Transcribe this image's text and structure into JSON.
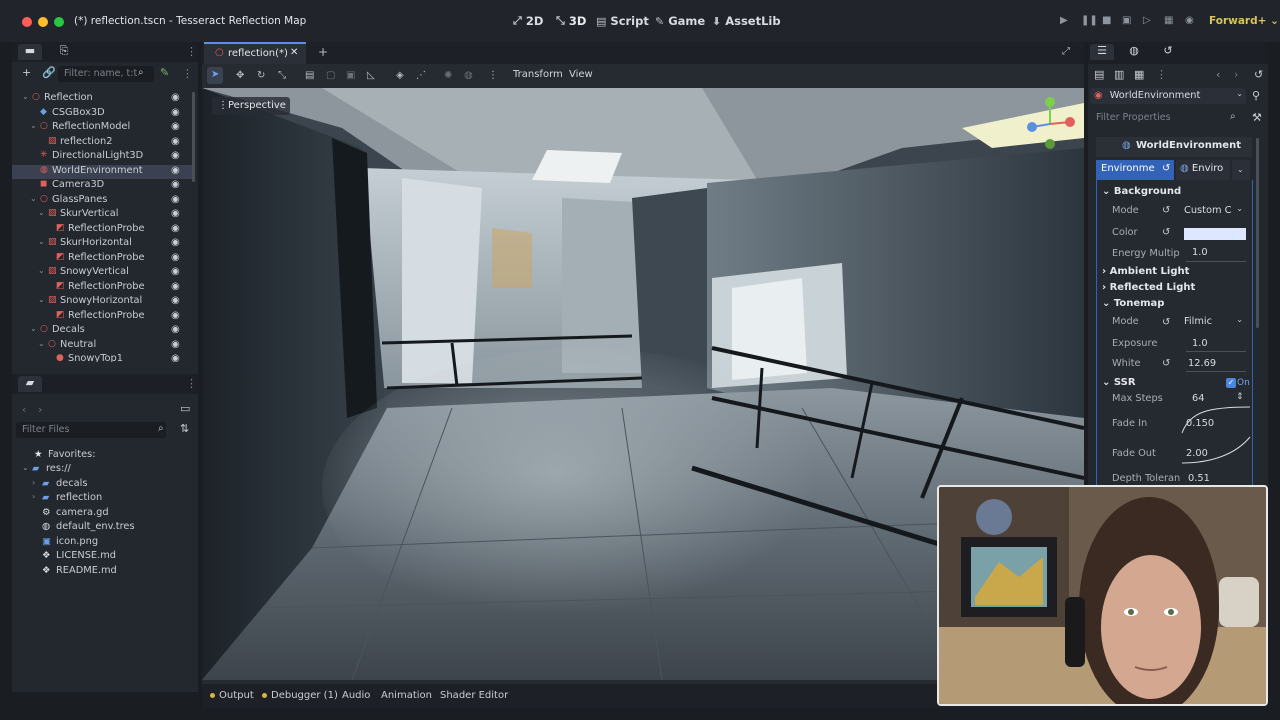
{
  "window": {
    "title": "(*) reflection.tscn - Tesseract Reflection Map",
    "modes": [
      {
        "label": "2D",
        "icon": "2d-icon"
      },
      {
        "label": "3D",
        "icon": "3d-icon"
      },
      {
        "label": "Script",
        "icon": "script-icon"
      },
      {
        "label": "Game",
        "icon": "game-icon"
      },
      {
        "label": "AssetLib",
        "icon": "assetlib-icon"
      }
    ],
    "renderer": "Forward+"
  },
  "scene_dock": {
    "filter_placeholder": "Filter: name, t:t",
    "nodes": [
      {
        "label": "Reflection",
        "depth": 0,
        "icon": "node3d-icon",
        "expanded": true
      },
      {
        "label": "CSGBox3D",
        "depth": 1,
        "icon": "csgbox-icon"
      },
      {
        "label": "ReflectionModel",
        "depth": 1,
        "icon": "node3d-icon",
        "expanded": true
      },
      {
        "label": "reflection2",
        "depth": 2,
        "icon": "mesh-icon"
      },
      {
        "label": "DirectionalLight3D",
        "depth": 1,
        "icon": "light-icon"
      },
      {
        "label": "WorldEnvironment",
        "depth": 1,
        "icon": "world-environment-icon",
        "selected": true
      },
      {
        "label": "Camera3D",
        "depth": 1,
        "icon": "camera-icon"
      },
      {
        "label": "GlassPanes",
        "depth": 1,
        "icon": "node3d-icon",
        "expanded": true
      },
      {
        "label": "SkurVertical",
        "depth": 2,
        "icon": "mesh-icon",
        "expanded": true
      },
      {
        "label": "ReflectionProbe",
        "depth": 3,
        "icon": "reflection-probe-icon"
      },
      {
        "label": "SkurHorizontal",
        "depth": 2,
        "icon": "mesh-icon",
        "expanded": true
      },
      {
        "label": "ReflectionProbe",
        "depth": 3,
        "icon": "reflection-probe-icon"
      },
      {
        "label": "SnowyVertical",
        "depth": 2,
        "icon": "mesh-icon",
        "expanded": true
      },
      {
        "label": "ReflectionProbe",
        "depth": 3,
        "icon": "reflection-probe-icon"
      },
      {
        "label": "SnowyHorizontal",
        "depth": 2,
        "icon": "mesh-icon",
        "expanded": true
      },
      {
        "label": "ReflectionProbe",
        "depth": 3,
        "icon": "reflection-probe-icon"
      },
      {
        "label": "Decals",
        "depth": 1,
        "icon": "node3d-icon",
        "expanded": true
      },
      {
        "label": "Neutral",
        "depth": 2,
        "icon": "node3d-icon",
        "expanded": true
      },
      {
        "label": "SnowyTop1",
        "depth": 3,
        "icon": "decal-icon"
      }
    ]
  },
  "filesystem": {
    "filter_placeholder": "Filter Files",
    "favorites_label": "Favorites:",
    "items": [
      {
        "label": "res://",
        "depth": 0,
        "icon": "folder-icon",
        "expanded": true
      },
      {
        "label": "decals",
        "depth": 1,
        "icon": "folder-icon"
      },
      {
        "label": "reflection",
        "depth": 1,
        "icon": "folder-icon"
      },
      {
        "label": "camera.gd",
        "depth": 1,
        "icon": "gear-icon"
      },
      {
        "label": "default_env.tres",
        "depth": 1,
        "icon": "globe-icon"
      },
      {
        "label": "icon.png",
        "depth": 1,
        "icon": "image-icon"
      },
      {
        "label": "LICENSE.md",
        "depth": 1,
        "icon": "document-icon"
      },
      {
        "label": "README.md",
        "depth": 1,
        "icon": "document-icon"
      }
    ]
  },
  "editor": {
    "scene_tab": "reflection(*)",
    "toolbar_menus": [
      "Transform",
      "View"
    ],
    "viewport_label": "Perspective"
  },
  "bottom_panel": {
    "tabs": [
      "Output",
      "Debugger (1)",
      "Audio",
      "Animation",
      "Shader Editor"
    ]
  },
  "inspector": {
    "node_select": "WorldEnvironment",
    "filter_placeholder": "Filter Properties",
    "resource_header": "WorldEnvironment",
    "tab_environment": "Environme",
    "tab_enviro": "Enviro",
    "sections": {
      "background": "Background",
      "ambient": "Ambient Light",
      "reflected": "Reflected Light",
      "tonemap": "Tonemap",
      "ssr": "SSR"
    },
    "props": {
      "bg_mode_label": "Mode",
      "bg_mode_value": "Custom C",
      "color_label": "Color",
      "color_value": "#dde7ff",
      "energy_label": "Energy Multip",
      "energy_value": "1.0",
      "tm_mode_label": "Mode",
      "tm_mode_value": "Filmic",
      "exposure_label": "Exposure",
      "exposure_value": "1.0",
      "white_label": "White",
      "white_value": "12.69",
      "ssr_on": "On",
      "max_steps_label": "Max Steps",
      "max_steps_value": "64",
      "fade_in_label": "Fade In",
      "fade_in_value": "0.150",
      "fade_out_label": "Fade Out",
      "fade_out_value": "2.00",
      "depth_label": "Depth Toleran",
      "depth_value": "0.51"
    }
  },
  "colors": {
    "accent": "#5b8fe0",
    "renderer": "#d8c35a",
    "node_red": "#e0605a",
    "folder_blue": "#6c9fe6"
  }
}
